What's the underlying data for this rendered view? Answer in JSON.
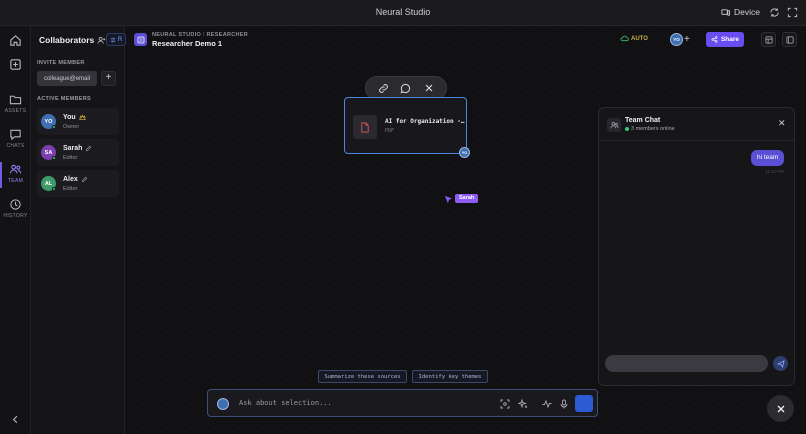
{
  "window": {
    "title": "Neural Studio",
    "device_label": "Device"
  },
  "rail": {
    "items": [
      {
        "label": "",
        "icon": "home-icon"
      },
      {
        "label": "",
        "icon": "add-square-icon"
      },
      {
        "label": "ASSETS",
        "icon": "folder-icon"
      },
      {
        "label": "CHATS",
        "icon": "chat-icon"
      },
      {
        "label": "TEAM",
        "icon": "team-icon",
        "active": true
      },
      {
        "label": "HISTORY",
        "icon": "history-icon"
      }
    ]
  },
  "team": {
    "title": "Collaborators",
    "invite_section": "INVITE MEMBER",
    "invite_value": "colleague@email",
    "active_section": "ACTIVE MEMBERS",
    "members": [
      {
        "initials": "YO",
        "name": "You",
        "role": "Owner",
        "color": "#3f6fb0"
      },
      {
        "initials": "SA",
        "name": "Sarah",
        "role": "Editor",
        "color": "#7b3fb0"
      },
      {
        "initials": "AL",
        "name": "Alex",
        "role": "Editor",
        "color": "#3f9a6a"
      }
    ]
  },
  "header": {
    "r_button": "R",
    "crumb_a": "NEURAL STUDIO",
    "crumb_b": "RESEARCHER",
    "project_name": "Researcher Demo 1",
    "auto_label": "AUTO",
    "avatar_initials": "YO",
    "share_label": "Share"
  },
  "canvas": {
    "doc_title": "AI for Organization -…",
    "doc_type": "PDF",
    "doc_badge": "YO",
    "cursor_user": "Sarah",
    "chips": [
      "Summarize these sources",
      "Identify key themes"
    ],
    "prompt_placeholder": "Ask about selection..."
  },
  "chat": {
    "title": "Team Chat",
    "subtitle": "3 members online",
    "message": "hi team",
    "message_time": "11:12 PM"
  },
  "colors": {
    "accent": "#6a4df0",
    "selection": "#4a88e0",
    "online": "#2ecc71"
  }
}
